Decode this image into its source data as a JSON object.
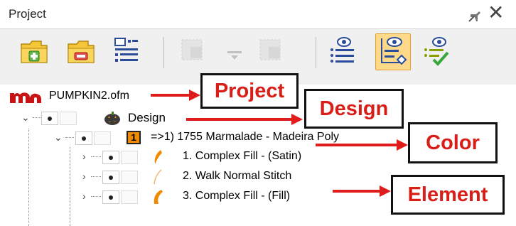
{
  "panel": {
    "title": "Project"
  },
  "toolbar": {
    "buttons": [
      "add-folder-icon",
      "remove-folder-icon",
      "tree-properties-icon",
      "move-up-icon",
      "move-down-icon",
      "move-last-icon",
      "show-list-icon",
      "visibility-active-icon",
      "visibility-check-icon"
    ]
  },
  "tree": {
    "project": "PUMPKIN2.ofm",
    "design": "Design",
    "color_number": "1",
    "color": "=>1) 1755 Marmalade - Madeira Poly",
    "elements": [
      "1. Complex Fill - (Satin)",
      "2. Walk Normal Stitch",
      "3. Complex Fill - (Fill)"
    ]
  },
  "callouts": {
    "project": "Project",
    "design": "Design",
    "color": "Color",
    "element": "Element"
  },
  "colors": {
    "accent_red": "#d91e18",
    "toolbar_active": "#ffd98a",
    "thread_orange": "#f08a00"
  }
}
